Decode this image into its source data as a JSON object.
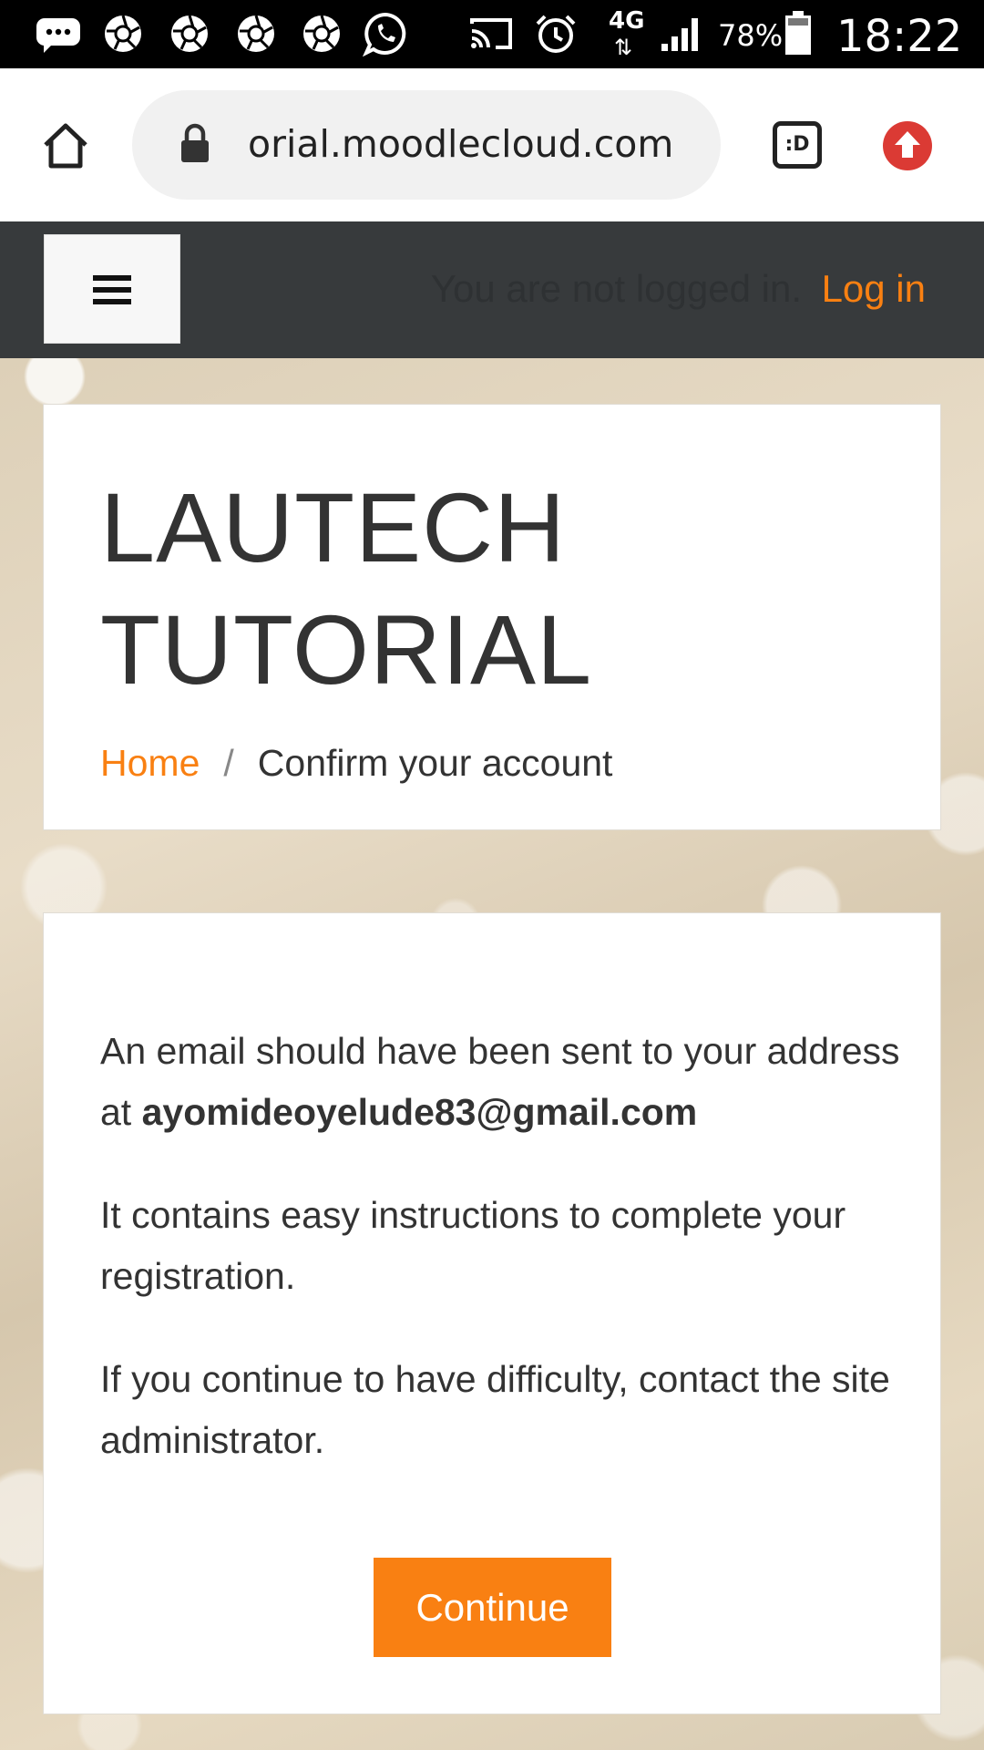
{
  "status_bar": {
    "battery": "78%",
    "time": "18:22",
    "network": "4G",
    "icons": [
      "messages-icon",
      "aperture-icon",
      "aperture-icon",
      "aperture-icon",
      "aperture-icon",
      "whatsapp-icon",
      "cast-icon",
      "alarm-icon",
      "network-4g-icon",
      "signal-icon",
      "battery-icon"
    ]
  },
  "browser": {
    "url": "orial.moodlecloud.com",
    "icons": [
      "home-icon",
      "lock-icon",
      "tab-switcher-icon",
      "upload-icon"
    ],
    "tab_badge": ":D"
  },
  "navbar": {
    "not_logged_in": "You are not logged in.",
    "login_label": "Log in",
    "accent": "#f98012"
  },
  "header": {
    "site_title": "LAUTECH TUTORIAL",
    "breadcrumb": {
      "home": "Home",
      "separator": "/",
      "current": "Confirm your account"
    }
  },
  "content": {
    "line1_prefix": "An email should have been sent to your address at",
    "email": "ayomideoyelude83@gmail.com",
    "line2": "It contains easy instructions to complete your registration.",
    "line3": "If you continue to have difficulty, contact the site administrator.",
    "continue_label": "Continue"
  }
}
